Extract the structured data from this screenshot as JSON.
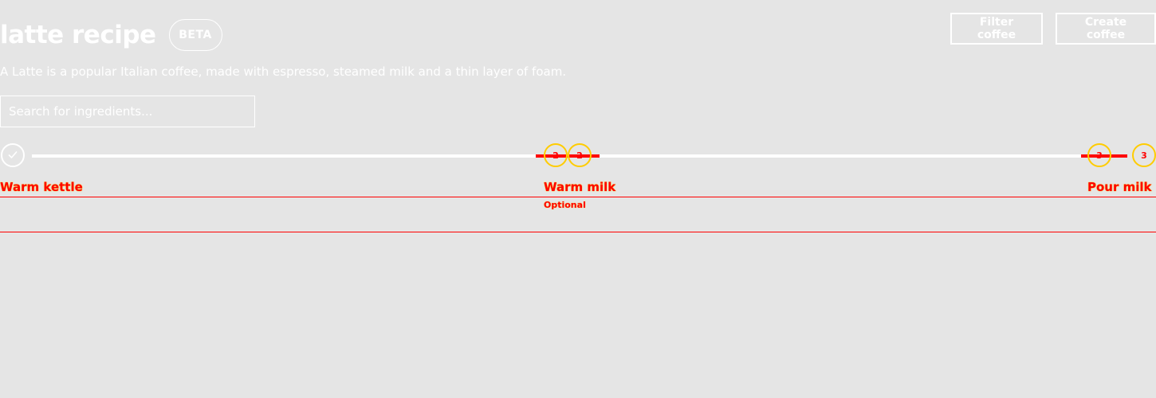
{
  "header": {
    "title": "latte recipe",
    "badge": "BETA"
  },
  "actions": {
    "filter_label": "Filter coffee",
    "create_label": "Create coffee"
  },
  "description": "A Latte is a popular Italian coffee, made with espresso, steamed milk and a thin layer of foam.",
  "search": {
    "placeholder": "Search for ingredients...",
    "value": ""
  },
  "steps": [
    {
      "label": "Warm kettle",
      "status": "completed",
      "icon": "check-icon"
    },
    {
      "label": "Warm milk",
      "sub": "Optional",
      "status": "current",
      "marker_a": "2",
      "marker_b": "2"
    },
    {
      "label": "Pour milk",
      "status": "upcoming",
      "marker_a": "3",
      "marker_b": "3"
    }
  ],
  "colors": {
    "background": "#e5e5e5",
    "foreground": "#ffffff",
    "highlight_stroke": "#ff0000",
    "highlight_fill": "#ffcc00"
  }
}
